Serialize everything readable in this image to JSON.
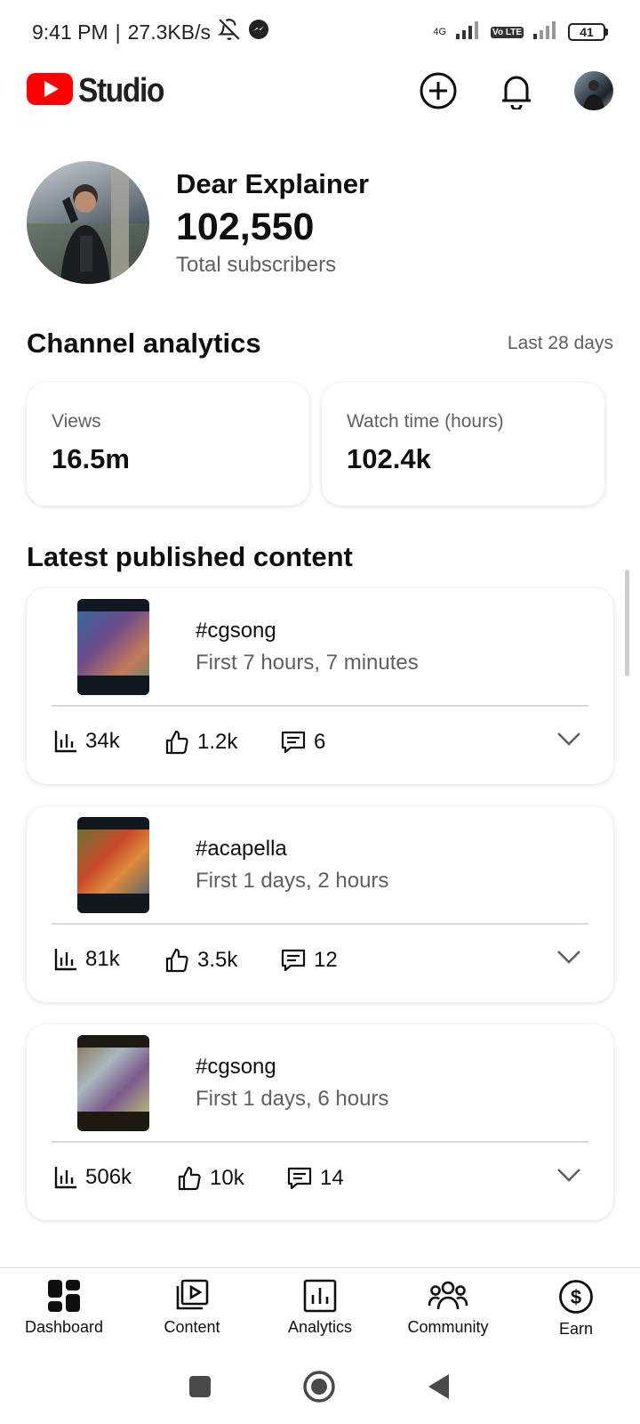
{
  "status_bar": {
    "time": "9:41 PM",
    "separator": "|",
    "speed": "27.3KB/s",
    "network": "4G",
    "volte": "Vo LTE",
    "battery": "41"
  },
  "header": {
    "app_name": "Studio",
    "brand_color": "#ff0000",
    "actions": {
      "create_icon": "plus-circle-icon",
      "notifications_icon": "bell-icon",
      "account_icon": "avatar"
    }
  },
  "channel": {
    "name": "Dear Explainer",
    "subscribers": "102,550",
    "subscribers_label": "Total subscribers"
  },
  "analytics": {
    "title": "Channel analytics",
    "period": "Last 28 days",
    "metrics": [
      {
        "label": "Views",
        "value": "16.5m"
      },
      {
        "label": "Watch time (hours)",
        "value": "102.4k"
      }
    ]
  },
  "latest": {
    "title": "Latest published content",
    "items": [
      {
        "title": "#cgsong",
        "subtitle": "First 7 hours, 7 minutes",
        "views": "34k",
        "likes": "1.2k",
        "comments": "6"
      },
      {
        "title": "#acapella",
        "subtitle": "First 1 days, 2 hours",
        "views": "81k",
        "likes": "3.5k",
        "comments": "12"
      },
      {
        "title": "#cgsong",
        "subtitle": "First 1 days, 6 hours",
        "views": "506k",
        "likes": "10k",
        "comments": "14"
      }
    ]
  },
  "bottom_nav": {
    "items": [
      {
        "label": "Dashboard",
        "icon": "dashboard-icon",
        "active": true
      },
      {
        "label": "Content",
        "icon": "content-icon"
      },
      {
        "label": "Analytics",
        "icon": "analytics-icon"
      },
      {
        "label": "Community",
        "icon": "community-icon"
      },
      {
        "label": "Earn",
        "icon": "dollar-icon"
      }
    ]
  },
  "system_nav": {
    "recents_icon": "square-icon",
    "home_icon": "circle-icon",
    "back_icon": "triangle-back-icon"
  }
}
